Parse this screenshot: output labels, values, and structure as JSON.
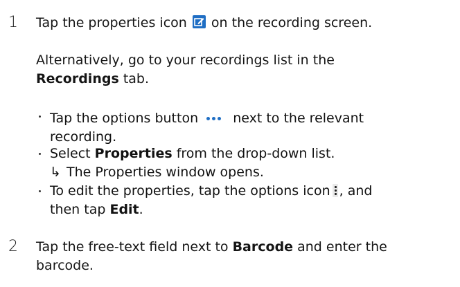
{
  "step1": {
    "number": "1",
    "text_before_icon": "Tap the properties icon",
    "text_after_icon": "on the recording screen.",
    "properties_icon": "edit-properties-icon",
    "alt_text_1": "Alternatively, go to your recordings list in the",
    "alt_tab_name": "Recordings",
    "alt_text_2": "tab.",
    "bullets": [
      {
        "before_icon": "Tap the options button",
        "icon": "more-horizontal-icon",
        "after_icon": "next to the relevant",
        "line2": "recording."
      },
      {
        "text_before": "Select",
        "bold": "Properties",
        "text_after": "from the drop-down list.",
        "result_arrow": "↳",
        "result": "The Properties window opens."
      },
      {
        "before_icon": "To edit the properties, tap the options icon",
        "icon": "more-vertical-icon",
        "after_icon": ", and",
        "line2_before": "then tap",
        "line2_bold": "Edit",
        "line2_after": "."
      }
    ]
  },
  "step2": {
    "number": "2",
    "text_before": "Tap the free-text field next to",
    "bold": "Barcode",
    "text_after": "and enter the",
    "line2": "barcode."
  },
  "colors": {
    "icon_blue": "#1f6ec4",
    "text": "#151515"
  }
}
